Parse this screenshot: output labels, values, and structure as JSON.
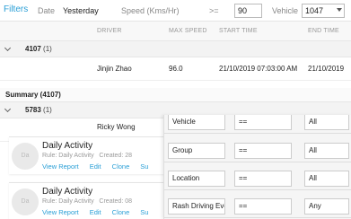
{
  "filter_bar": {
    "title": "Filters",
    "date_label": "Date",
    "date_value": "Yesterday",
    "speed_label": "Speed (Kms/Hr)",
    "speed_operator": ">=",
    "speed_value": "90",
    "vehicle_label": "Vehicle",
    "vehicle_value": "1047"
  },
  "table": {
    "columns": [
      "DRIVER",
      "MAX SPEED",
      "START TIME",
      "END TIME"
    ],
    "groups": [
      {
        "name": "4107",
        "count": "(1)",
        "rows": [
          {
            "driver": "Jinjin Zhao",
            "max_speed": "96.0",
            "start_time": "21/10/2019 07:03:00 AM",
            "end_time": "21/10/2019"
          }
        ],
        "summary": "Summary (4107)"
      },
      {
        "name": "5783",
        "count": "(1)",
        "rows": [
          {
            "driver": "Ricky Wong",
            "max_speed": "",
            "start_time": "",
            "end_time": ""
          }
        ]
      }
    ]
  },
  "cards": [
    {
      "avatar": "Da",
      "title": "Daily Activity",
      "rule": "Rule: Daily Activity",
      "created": "Created: 28",
      "links": [
        "View Report",
        "Edit",
        "Clone",
        "Su"
      ]
    },
    {
      "avatar": "Da",
      "title": "Daily Activity",
      "rule": "Rule: Daily Activity",
      "created": "Created: 08",
      "links": [
        "View Report",
        "Edit",
        "Clone",
        "Su"
      ]
    }
  ],
  "criteria": [
    {
      "field": "Vehicle",
      "operator": "==",
      "value": "All"
    },
    {
      "field": "Group",
      "operator": "==",
      "value": "All"
    },
    {
      "field": "Location",
      "operator": "==",
      "value": "All"
    },
    {
      "field": "Rash Driving Eve",
      "operator": "==",
      "value": "Any"
    }
  ],
  "colors": {
    "accent": "#2a9fd6"
  }
}
